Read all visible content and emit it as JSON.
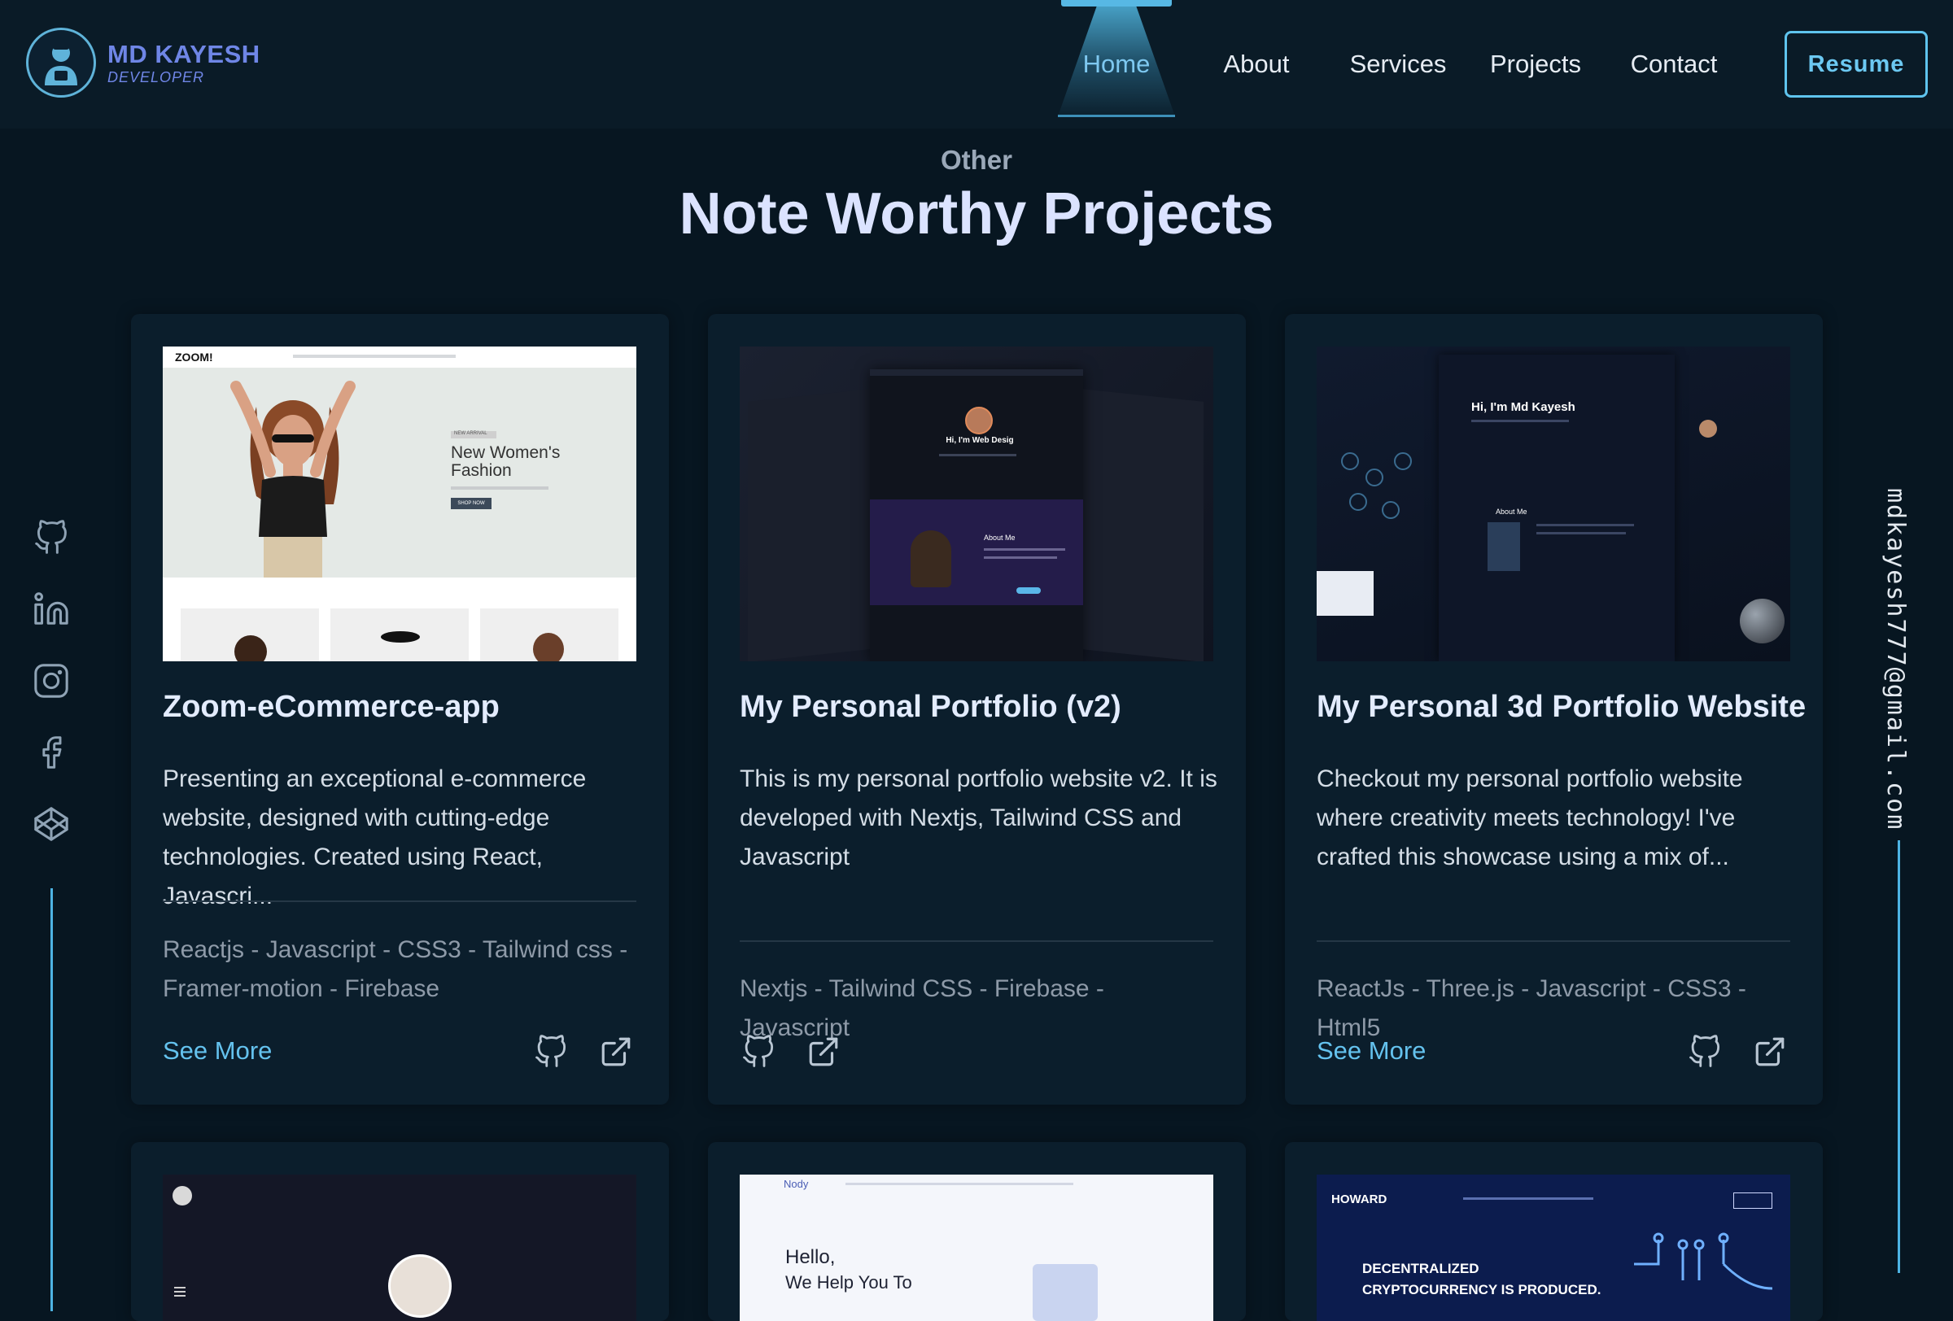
{
  "nav": {
    "logo": {
      "name": "MD KAYESH",
      "subtitle": "DEVELOPER"
    },
    "items": [
      {
        "label": "Home",
        "active": true
      },
      {
        "label": "About"
      },
      {
        "label": "Services"
      },
      {
        "label": "Projects"
      },
      {
        "label": "Contact"
      }
    ],
    "resume": "Resume"
  },
  "section": {
    "eyebrow": "Other",
    "title": "Note Worthy Projects"
  },
  "social": [
    "github-icon",
    "linkedin-icon",
    "instagram-icon",
    "facebook-icon",
    "codepen-icon"
  ],
  "email": "mdkayesh777@gmail.com",
  "projects": [
    {
      "title": "Zoom-eCommerce-app",
      "desc": "Presenting an exceptional e-commerce website, designed with cutting-edge technologies. Created using React, Javascri...",
      "tech": "Reactjs - Javascript - CSS3 - Tailwind css - Framer-motion - Firebase",
      "see_more": "See More",
      "preview": {
        "brand": "ZOOM!",
        "headline": "New Women's Fashion",
        "tag": "NEW ARRIVAL",
        "button": "SHOP NOW"
      }
    },
    {
      "title": "My Personal Portfolio (v2)",
      "desc": "This is my personal portfolio website v2. It is developed with Nextjs, Tailwind CSS and Javascript",
      "tech": "Nextjs - Tailwind CSS - Firebase - Javascript",
      "see_more": "",
      "preview": {
        "headline": "Hi, I'm Web Desig",
        "about": "About Me"
      }
    },
    {
      "title": "My Personal 3d Portfolio Website",
      "desc": "Checkout my personal portfolio website where creativity meets technology! I've crafted this showcase using a mix of...",
      "tech": "ReactJs - Three.js - Javascript - CSS3 - Html5",
      "see_more": "See More",
      "preview": {
        "headline": "Hi, I'm Md Kayesh",
        "about": "About Me"
      }
    }
  ],
  "next_row": [
    {
      "preview": {}
    },
    {
      "preview": {
        "brand": "Nody",
        "headline": "Hello,",
        "sub": "We Help You To"
      }
    },
    {
      "preview": {
        "brand": "HOWARD",
        "headline": "DECENTRALIZED",
        "sub": "CRYPTOCURRENCY IS PRODUCED."
      }
    }
  ],
  "colors": {
    "accent": "#5fc4ee",
    "background": "#071621",
    "card": "#0b1e2c",
    "logo": "#6f86e6"
  }
}
